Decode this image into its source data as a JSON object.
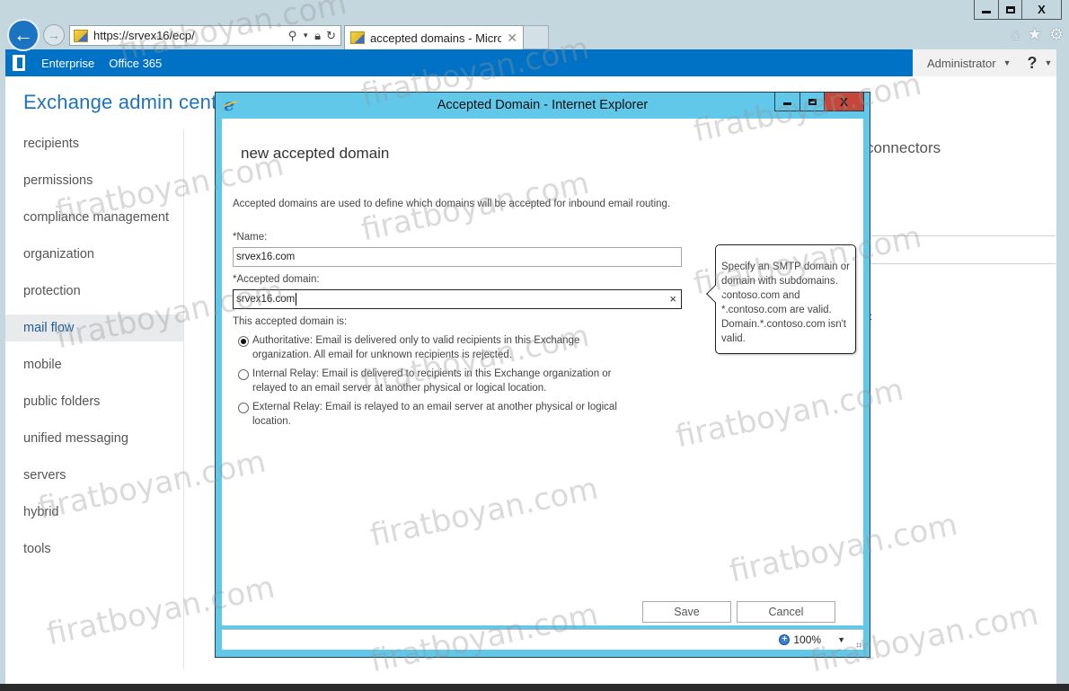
{
  "browser": {
    "address": "https://srvex16/ecp/",
    "tab_title": "accepted domains - Micros...",
    "window_controls": {
      "minimize": "",
      "maximize": "",
      "close": "X"
    },
    "icons": [
      "back-icon",
      "forward-icon",
      "search-icon",
      "lock-icon",
      "refresh-icon",
      "home-icon",
      "favorites-star-icon",
      "settings-gear-icon"
    ]
  },
  "o365_bar": {
    "links": [
      "Enterprise",
      "Office 365"
    ],
    "user": "Administrator",
    "help": "?"
  },
  "eac": {
    "title": "Exchange admin center",
    "nav": [
      {
        "label": "recipients",
        "active": false
      },
      {
        "label": "permissions",
        "active": false
      },
      {
        "label": "compliance management",
        "active": false
      },
      {
        "label": "organization",
        "active": false
      },
      {
        "label": "protection",
        "active": false
      },
      {
        "label": "mail flow",
        "active": true
      },
      {
        "label": "mobile",
        "active": false
      },
      {
        "label": "public folders",
        "active": false
      },
      {
        "label": "unified messaging",
        "active": false
      },
      {
        "label": "servers",
        "active": false
      },
      {
        "label": "hybrid",
        "active": false
      },
      {
        "label": "tools",
        "active": false
      }
    ],
    "background_tab": "connectors"
  },
  "dialog": {
    "window_title": "Accepted Domain - Internet Explorer",
    "close_label": "X",
    "heading": "new accepted domain",
    "description": "Accepted domains are used to define which domains will be accepted for inbound email routing.",
    "name_label": "*Name:",
    "name_value": "srvex16.com",
    "domain_label": "*Accepted domain:",
    "domain_value": "srvex16.com",
    "clear_label": "×",
    "type_label": "This accepted domain is:",
    "types": [
      {
        "label": "Authoritative: Email is delivered only to valid recipients in this Exchange organization. All email for unknown recipients is rejected.",
        "checked": true
      },
      {
        "label": "Internal Relay: Email is delivered to recipients in this Exchange organization or relayed to an email server at another physical or logical location.",
        "checked": false
      },
      {
        "label": "External Relay: Email is relayed to an email server at another physical or logical location.",
        "checked": false
      }
    ],
    "tooltip": "Specify an SMTP domain or domain with subdomains. contoso.com and *.contoso.com are valid. Domain.*.contoso.com isn't valid.",
    "save_label": "Save",
    "cancel_label": "Cancel",
    "zoom_level": "100%"
  },
  "watermark": "firatboyan.com",
  "colors": {
    "o365_blue": "#0072c6",
    "eac_title_blue": "#1e73be",
    "dialog_frame": "#62c8e9",
    "close_red": "#c6473a"
  }
}
